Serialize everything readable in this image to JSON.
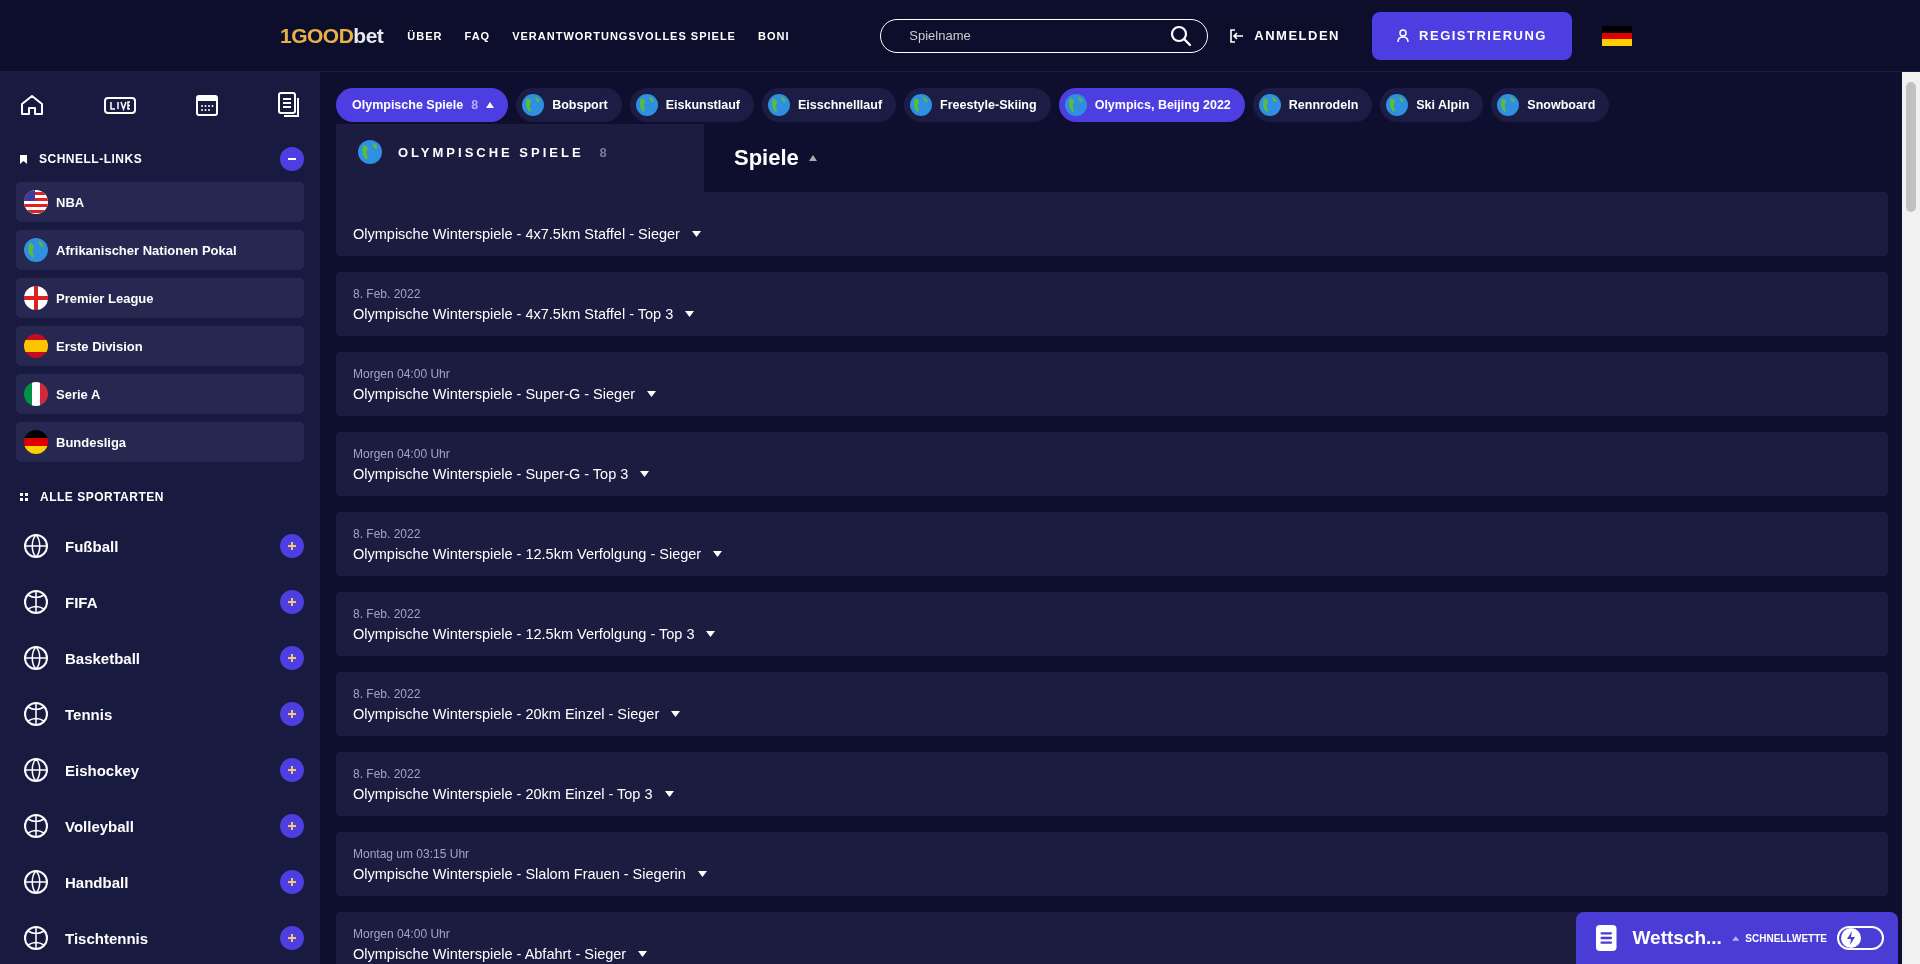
{
  "header": {
    "logo": {
      "brand": "1GOOD",
      "suffix": "bet"
    },
    "nav": [
      "ÜBER",
      "FAQ",
      "VERANTWORTUNGSVOLLES SPIELE",
      "BONI"
    ],
    "search": {
      "placeholder": "Spielname"
    },
    "login": "ANMELDEN",
    "register": "REGISTRIERUNG"
  },
  "sidebar": {
    "quick_links": {
      "title": "SCHNELL-LINKS",
      "expanded": true,
      "items": [
        {
          "label": "NBA"
        },
        {
          "label": "Afrikanischer Nationen Pokal"
        },
        {
          "label": "Premier League"
        },
        {
          "label": "Erste Division"
        },
        {
          "label": "Serie A"
        },
        {
          "label": "Bundesliga"
        }
      ]
    },
    "all_sports": {
      "title": "ALLE SPORTARTEN",
      "items": [
        {
          "label": "Fußball"
        },
        {
          "label": "FIFA"
        },
        {
          "label": "Basketball"
        },
        {
          "label": "Tennis"
        },
        {
          "label": "Eishockey"
        },
        {
          "label": "Volleyball"
        },
        {
          "label": "Handball"
        },
        {
          "label": "Tischtennis"
        }
      ]
    }
  },
  "tabs": [
    {
      "kind": "menu",
      "label": "Olympische Spiele",
      "count": "8",
      "selected": true,
      "expanded": true
    },
    {
      "kind": "league",
      "label": "Bobsport",
      "selected": false
    },
    {
      "kind": "league",
      "label": "Eiskunstlauf",
      "selected": false
    },
    {
      "kind": "league",
      "label": "Eisschnelllauf",
      "selected": false
    },
    {
      "kind": "league",
      "label": "Freestyle-Skiing",
      "selected": false
    },
    {
      "kind": "league",
      "label": "Olympics, Beijing 2022",
      "selected": true
    },
    {
      "kind": "league",
      "label": "Rennrodeln",
      "selected": false
    },
    {
      "kind": "league",
      "label": "Ski Alpin",
      "selected": false
    },
    {
      "kind": "league",
      "label": "Snowboard",
      "selected": false
    }
  ],
  "dropdown": {
    "title": "OLYMPISCHE SPIELE",
    "count": "8"
  },
  "heading": "Spiele",
  "events": [
    {
      "title": "Olympische Winterspiele - 4x7.5km Staffel - Sieger"
    },
    {
      "date": "8. Feb. 2022",
      "title": "Olympische Winterspiele - 4x7.5km Staffel - Top 3"
    },
    {
      "date": "Morgen 04:00 Uhr",
      "title": "Olympische Winterspiele - Super-G - Sieger"
    },
    {
      "date": "Morgen 04:00 Uhr",
      "title": "Olympische Winterspiele - Super-G - Top 3"
    },
    {
      "date": "8. Feb. 2022",
      "title": "Olympische Winterspiele - 12.5km Verfolgung - Sieger"
    },
    {
      "date": "8. Feb. 2022",
      "title": "Olympische Winterspiele - 12.5km Verfolgung - Top 3"
    },
    {
      "date": "8. Feb. 2022",
      "title": "Olympische Winterspiele - 20km Einzel - Sieger"
    },
    {
      "date": "8. Feb. 2022",
      "title": "Olympische Winterspiele - 20km Einzel - Top 3"
    },
    {
      "date": "Montag um 03:15 Uhr",
      "title": "Olympische Winterspiele - Slalom Frauen - Siegerin"
    },
    {
      "date": "Morgen 04:00 Uhr",
      "title": "Olympische Winterspiele - Abfahrt - Sieger"
    }
  ],
  "bet_slip": {
    "title": "Wettsch...",
    "quick_bet_label": "SCHNELLWETTE",
    "quick_bet_on": false
  }
}
